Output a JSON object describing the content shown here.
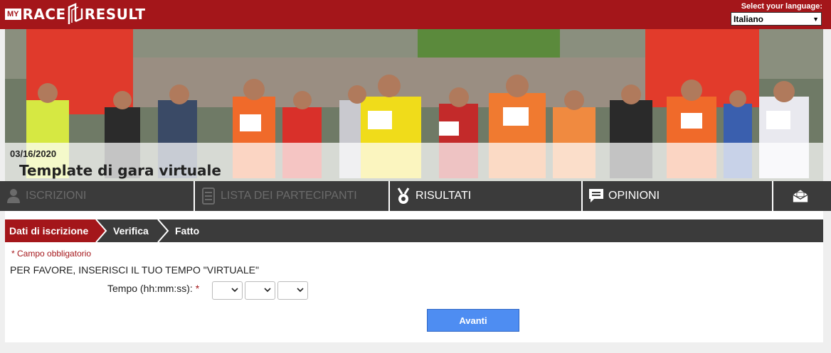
{
  "header": {
    "logo_my": "MY",
    "logo_race": "RACE",
    "logo_result": "RESULT",
    "language_label": "Select your language:",
    "language_selected": "Italiano"
  },
  "event": {
    "date": "03/16/2020",
    "title": "Template di gara virtuale"
  },
  "nav": [
    {
      "label": "ISCRIZIONI",
      "icon": "person-icon",
      "disabled": true
    },
    {
      "label": "LISTA DEI PARTECIPANTI",
      "icon": "list-icon",
      "disabled": true
    },
    {
      "label": "RISULTATI",
      "icon": "medal-icon",
      "disabled": false
    },
    {
      "label": "OPINIONI",
      "icon": "comment-icon",
      "disabled": false
    },
    {
      "label": "",
      "icon": "mail-icon",
      "disabled": false
    }
  ],
  "steps": [
    {
      "label": "Dati di iscrizione",
      "active": true
    },
    {
      "label": "Verifica",
      "active": false
    },
    {
      "label": "Fatto",
      "active": false
    }
  ],
  "form": {
    "required_star": "*",
    "required_note": "Campo obbligatorio",
    "instruction": "PER FAVORE, INSERISCI IL TUO TEMPO \"VIRTUALE\"",
    "time_label": "Tempo (hh:mm:ss):",
    "hours_value": "",
    "minutes_value": "",
    "seconds_value": "",
    "submit_label": "Avanti"
  },
  "colors": {
    "brand": "#a4161a",
    "nav_bg": "#3b3b3b",
    "button": "#4e8df2"
  }
}
